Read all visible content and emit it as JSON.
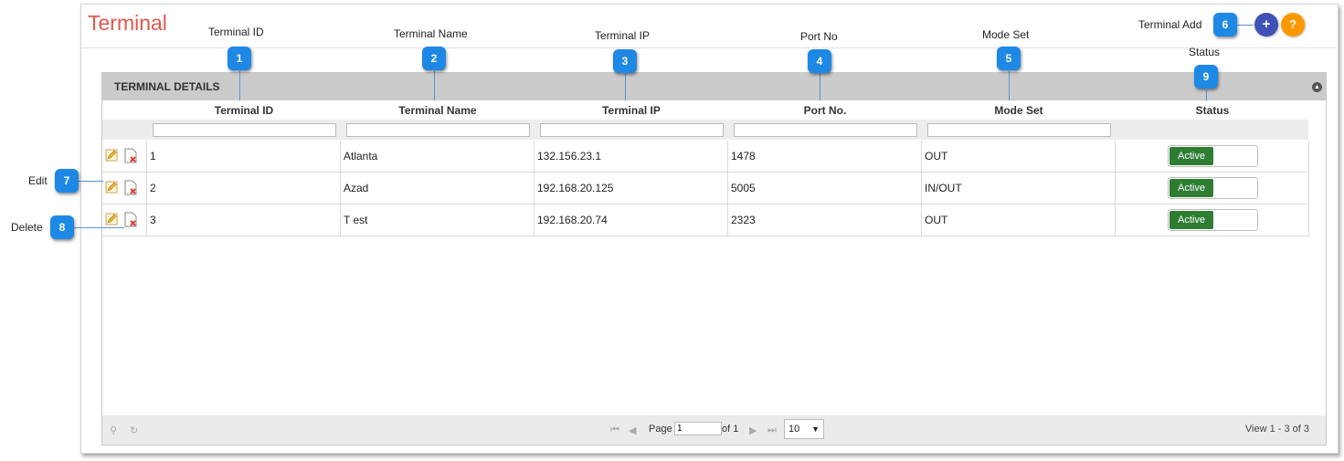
{
  "page": {
    "title": "Terminal"
  },
  "header": {
    "add_label": "+",
    "help_label": "?"
  },
  "panel": {
    "title": "TERMINAL DETAILS"
  },
  "columns": [
    "Terminal ID",
    "Terminal Name",
    "Terminal IP",
    "Port No.",
    "Mode Set",
    "Status"
  ],
  "rows": [
    {
      "id": "1",
      "name": "Atlanta",
      "ip": "132.156.23.1",
      "port": "1478",
      "mode": "OUT",
      "status": "Active"
    },
    {
      "id": "2",
      "name": "Azad",
      "ip": "192.168.20.125",
      "port": "5005",
      "mode": "IN/OUT",
      "status": "Active"
    },
    {
      "id": "3",
      "name": "T est",
      "ip": "192.168.20.74",
      "port": "2323",
      "mode": "OUT",
      "status": "Active"
    }
  ],
  "pager": {
    "page_label": "Page",
    "page_value": "1",
    "of_label": "of 1",
    "page_size": "10",
    "view_label": "View 1 - 3 of 3"
  },
  "callouts": [
    {
      "num": "1",
      "label": "Terminal ID"
    },
    {
      "num": "2",
      "label": "Terminal Name"
    },
    {
      "num": "3",
      "label": "Terminal IP"
    },
    {
      "num": "4",
      "label": "Port No"
    },
    {
      "num": "5",
      "label": "Mode Set"
    },
    {
      "num": "6",
      "label": "Terminal Add"
    },
    {
      "num": "7",
      "label": "Edit"
    },
    {
      "num": "8",
      "label": "Delete"
    },
    {
      "num": "9",
      "label": "Status"
    }
  ],
  "colors": {
    "accent": "#1e88e5",
    "title": "#e2574c",
    "active": "#2e7d32",
    "add": "#3f51b5",
    "help": "#ff9800"
  }
}
